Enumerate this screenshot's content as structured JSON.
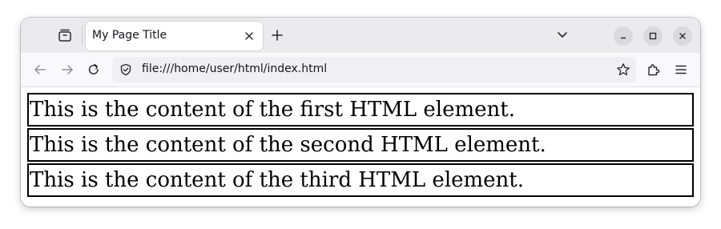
{
  "browser": {
    "tab": {
      "title": "My Page Title"
    },
    "address_bar": {
      "url": "file:///home/user/html/index.html"
    },
    "icons": {
      "tab_overview": "tab-overview-icon",
      "close_tab": "close-icon",
      "new_tab": "plus-icon",
      "tab_list": "chevron-down-icon",
      "minimize": "minimize-icon",
      "maximize": "maximize-icon",
      "close_window": "close-icon",
      "back": "arrow-left-icon",
      "forward": "arrow-right-icon",
      "reload": "reload-icon",
      "site_info": "shield-icon",
      "bookmark": "star-icon",
      "extensions": "puzzle-icon",
      "menu": "hamburger-menu-icon"
    }
  },
  "page": {
    "elements": [
      {
        "text": "This is the content of the first HTML element."
      },
      {
        "text": "This is the content of the second HTML element."
      },
      {
        "text": "This is the content of the third HTML element."
      }
    ]
  },
  "colors": {
    "tabbar_bg": "#ebebed",
    "navbar_bg": "#f9f9fb",
    "urlbar_bg": "#f0f0f4",
    "element_border": "#000000"
  }
}
